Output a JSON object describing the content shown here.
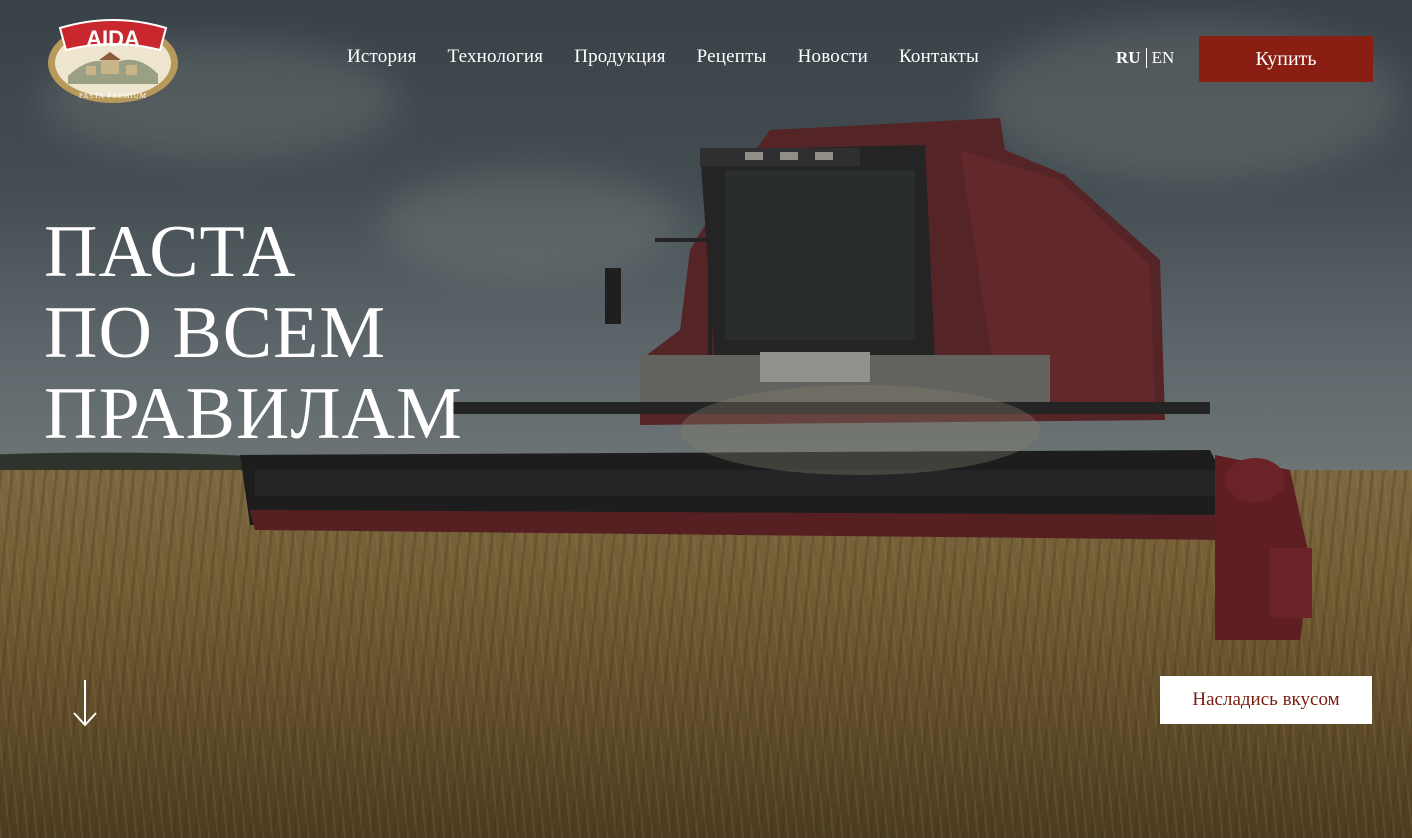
{
  "brand": {
    "logo_text": "AIDA",
    "logo_tagline": "PASTA PREMIUM",
    "colors": {
      "accent": "#8b1e12",
      "logo_red": "#c8272d",
      "logo_gold": "#b79a5b"
    }
  },
  "nav": {
    "items": [
      {
        "label": "История"
      },
      {
        "label": "Технология"
      },
      {
        "label": "Продукция"
      },
      {
        "label": "Рецепты"
      },
      {
        "label": "Новости"
      },
      {
        "label": "Контакты"
      }
    ]
  },
  "lang": {
    "ru": "RU",
    "en": "EN",
    "active": "RU"
  },
  "header": {
    "buy_label": "Купить"
  },
  "hero": {
    "lines": [
      "ПАСТА",
      "ПО ВСЕМ",
      "ПРАВИЛАМ"
    ],
    "cta_label": "Насладись вкусом",
    "scroll_icon": "arrow-down-icon"
  }
}
